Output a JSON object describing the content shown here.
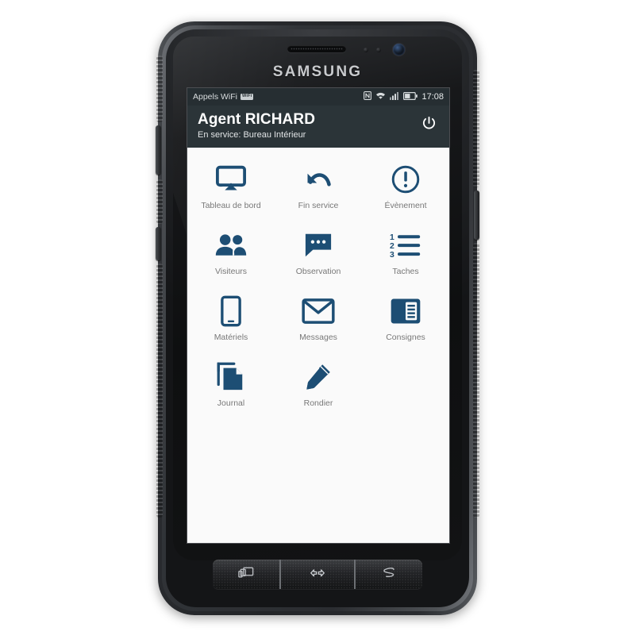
{
  "device": {
    "brand": "SAMSUNG",
    "hardware_buttons": [
      {
        "name": "recent-apps",
        "glyph": "recents-icon"
      },
      {
        "name": "home",
        "glyph": "home-icon"
      },
      {
        "name": "back",
        "glyph": "back-icon"
      }
    ]
  },
  "statusbar": {
    "carrier_label": "Appels WiFi",
    "wifi_calling_badge": "WiFi",
    "icons": [
      "nfc-icon",
      "wifi-icon",
      "signal-bars-icon",
      "battery-icon"
    ],
    "time": "17:08"
  },
  "appbar": {
    "title": "Agent RICHARD",
    "subtitle": "En service: Bureau Intérieur",
    "power_icon": "power-icon",
    "background": "#2b3438"
  },
  "theme": {
    "icon_color": "#1d4e74",
    "label_color": "#787878",
    "screen_background": "#fafafa",
    "statusbar_background": "#262e32"
  },
  "menu": {
    "tiles": [
      {
        "label": "Tableau de bord",
        "icon": "dashboard-screen-icon"
      },
      {
        "label": "Fin service",
        "icon": "undo-arrow-icon"
      },
      {
        "label": "Évènement",
        "icon": "alert-circle-icon"
      },
      {
        "label": "Visiteurs",
        "icon": "people-icon"
      },
      {
        "label": "Observation",
        "icon": "chat-bubble-icon"
      },
      {
        "label": "Taches",
        "icon": "numbered-list-icon"
      },
      {
        "label": "Matériels",
        "icon": "smartphone-icon"
      },
      {
        "label": "Messages",
        "icon": "envelope-icon"
      },
      {
        "label": "Consignes",
        "icon": "article-icon"
      },
      {
        "label": "Journal",
        "icon": "documents-copy-icon"
      },
      {
        "label": "Rondier",
        "icon": "pencil-icon"
      }
    ]
  }
}
